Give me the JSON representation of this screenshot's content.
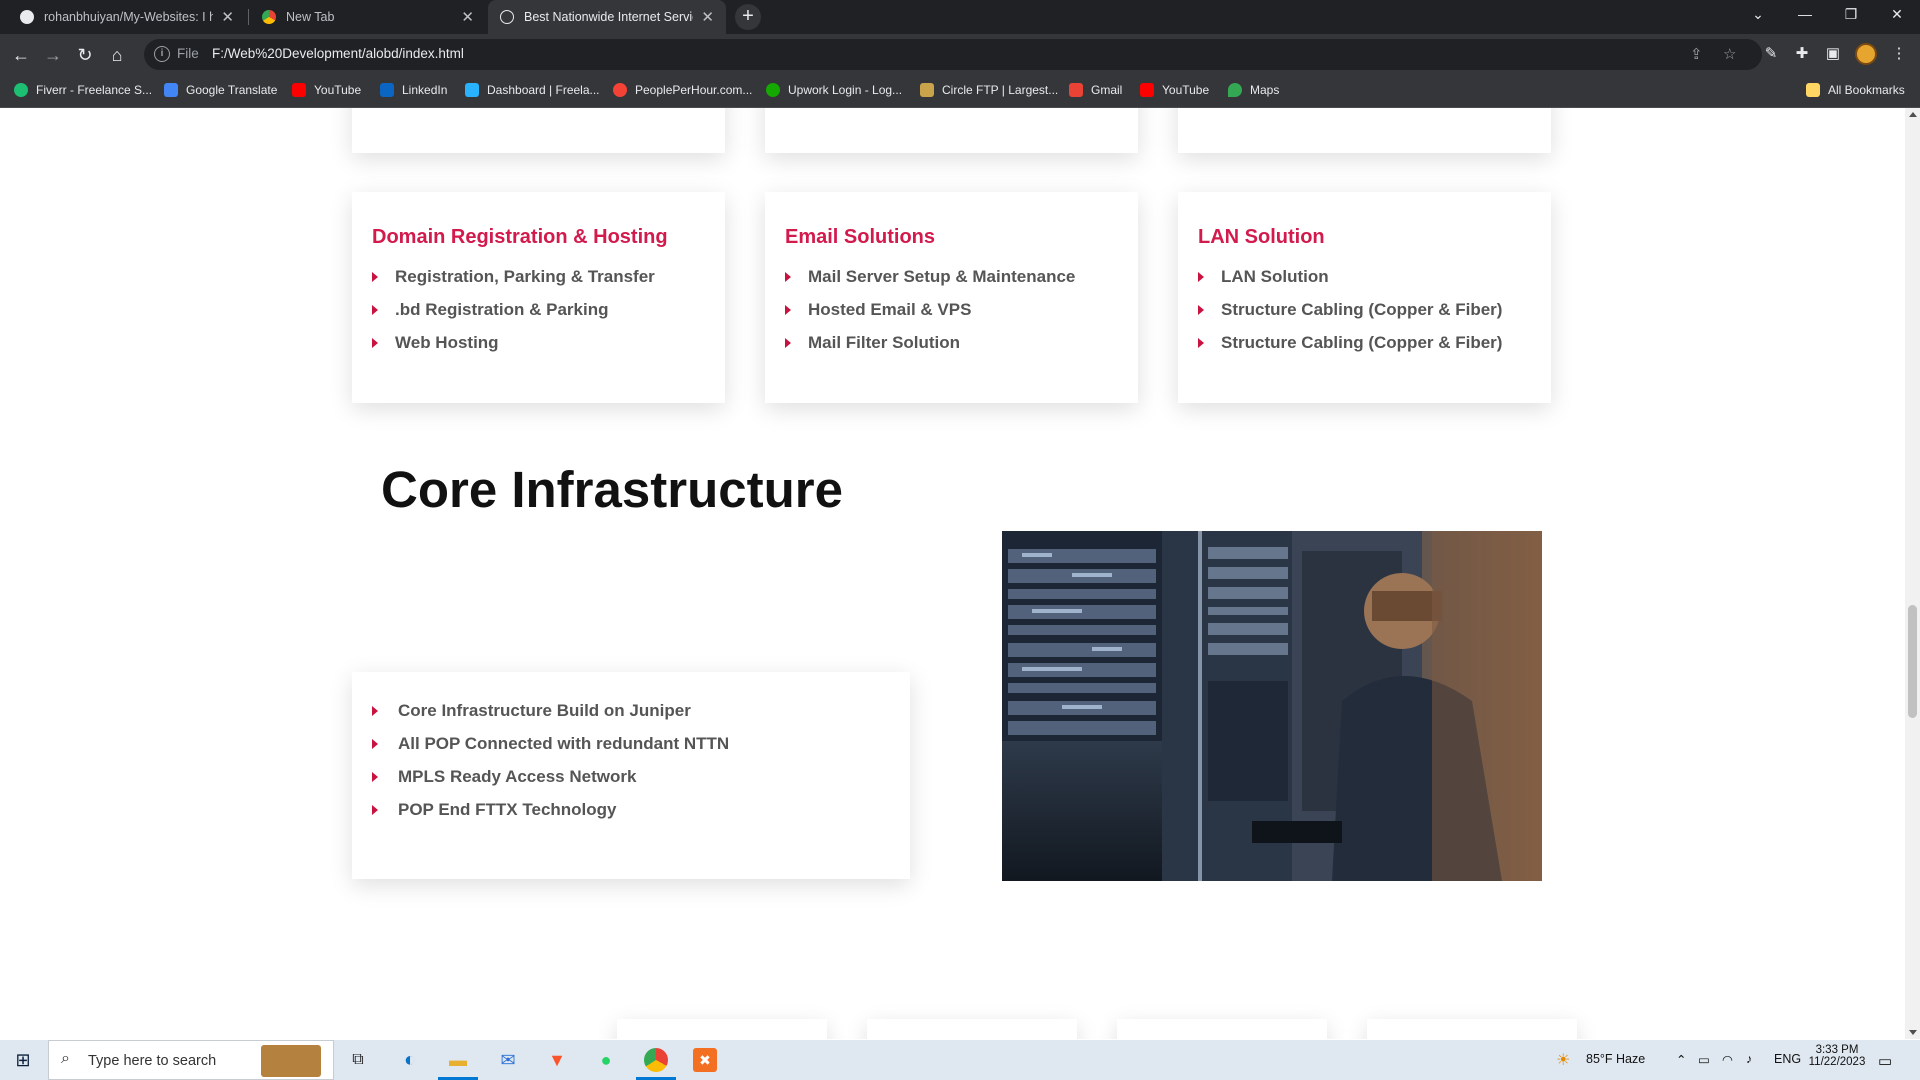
{
  "browser": {
    "tabs": [
      {
        "title": "rohanbhuiyan/My-Websites: I h",
        "icon": "github-icon",
        "active": false
      },
      {
        "title": "New Tab",
        "icon": "chrome-icon",
        "active": false
      },
      {
        "title": "Best Nationwide Internet Service",
        "icon": "globe-icon",
        "active": true
      }
    ],
    "new_tab": "+",
    "address": {
      "scheme_label": "File",
      "url": "F:/Web%20Development/alobd/index.html"
    },
    "bookmarks": [
      {
        "label": "Fiverr - Freelance S...",
        "icon": "fiverr-icon",
        "color": "#1dbf73"
      },
      {
        "label": "Google Translate",
        "icon": "translate-icon",
        "color": "#4285f4"
      },
      {
        "label": "YouTube",
        "icon": "youtube-icon",
        "color": "#ff0000"
      },
      {
        "label": "LinkedIn",
        "icon": "linkedin-icon",
        "color": "#0a66c2"
      },
      {
        "label": "Dashboard | Freela...",
        "icon": "freelancer-icon",
        "color": "#29b2fe"
      },
      {
        "label": "PeoplePerHour.com...",
        "icon": "peopleperhour-icon",
        "color": "#f44336"
      },
      {
        "label": "Upwork Login - Log...",
        "icon": "upwork-icon",
        "color": "#14a800"
      },
      {
        "label": "Circle FTP | Largest...",
        "icon": "circleftp-icon",
        "color": "#c9a44a"
      },
      {
        "label": "Gmail",
        "icon": "gmail-icon",
        "color": "#ea4335"
      },
      {
        "label": "YouTube",
        "icon": "youtube-icon",
        "color": "#ff0000"
      },
      {
        "label": "Maps",
        "icon": "maps-icon",
        "color": "#34a853"
      }
    ],
    "all_bookmarks": "All Bookmarks"
  },
  "page": {
    "service_cards": [
      {
        "title": "Domain Registration & Hosting",
        "items": [
          "Registration, Parking & Transfer",
          ".bd Registration & Parking",
          "Web Hosting"
        ]
      },
      {
        "title": "Email Solutions",
        "items": [
          "Mail Server Setup & Maintenance",
          "Hosted Email & VPS",
          "Mail Filter Solution"
        ]
      },
      {
        "title": "LAN Solution",
        "items": [
          "LAN Solution",
          "Structure Cabling (Copper & Fiber)",
          "Structure Cabling (Copper & Fiber)"
        ]
      }
    ],
    "core": {
      "heading": "Core Infrastructure",
      "items": [
        "Core Infrastructure Build on Juniper",
        "All POP Connected with redundant NTTN",
        "MPLS Ready Access Network",
        "POP End FTTX Technology"
      ]
    },
    "accent": "#d21a4c"
  },
  "taskbar": {
    "search_placeholder": "Type here to search",
    "weather": "85°F  Haze",
    "language": "ENG",
    "time": "3:33 PM",
    "date": "11/22/2023"
  }
}
